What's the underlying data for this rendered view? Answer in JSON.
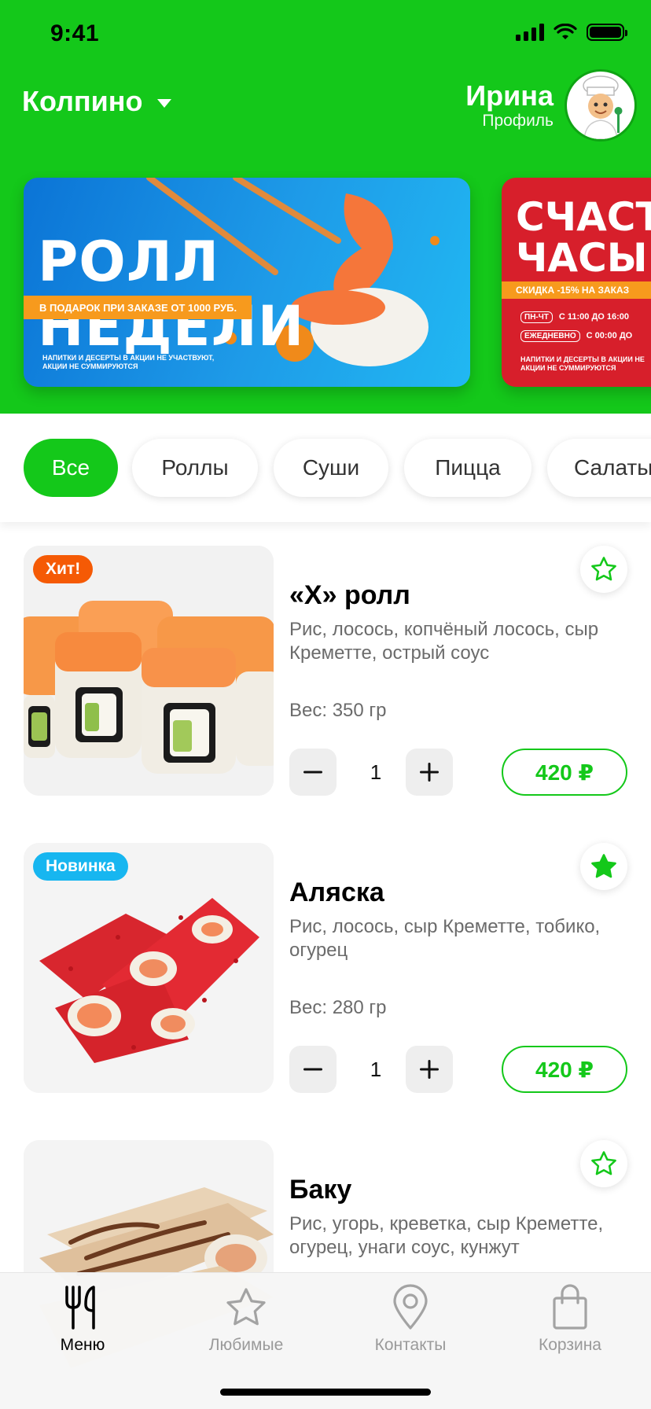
{
  "status_bar": {
    "time": "9:41"
  },
  "header": {
    "city": "Колпино",
    "profile_name": "Ирина",
    "profile_label": "Профиль"
  },
  "banners": [
    {
      "title": "РОЛЛ НЕДЕЛИ",
      "strip": "В ПОДАРОК ПРИ ЗАКАЗЕ ОТ 1000 РУБ.",
      "note": "НАПИТКИ И ДЕСЕРТЫ В АКЦИИ НЕ УЧАСТВУЮТ, АКЦИИ НЕ СУММИРУЮТСЯ"
    },
    {
      "title_line1": "СЧАСТЛ",
      "title_line2": "ЧАСЫ",
      "strip": "СКИДКА -15% НА ЗАКАЗ",
      "row1_tag": "ПН-ЧТ",
      "row1_text": "С 11:00 ДО 16:00",
      "row2_tag": "ЕЖЕДНЕВНО",
      "row2_text": "С 00:00 ДО",
      "note_line1": "НАПИТКИ И ДЕСЕРТЫ В АКЦИИ НЕ",
      "note_line2": "АКЦИИ НЕ СУММИРУЮТСЯ"
    }
  ],
  "categories": [
    {
      "label": "Все",
      "active": true
    },
    {
      "label": "Роллы",
      "active": false
    },
    {
      "label": "Суши",
      "active": false
    },
    {
      "label": "Пицца",
      "active": false
    },
    {
      "label": "Салаты",
      "active": false
    }
  ],
  "products": [
    {
      "badge": "Хит!",
      "name": "«X» ролл",
      "description": "Рис, лосось, копчёный лосось, сыр Креметте, острый соус",
      "weight": "Вес: 350 гр",
      "quantity": "1",
      "price": "420 ₽",
      "favorite": false
    },
    {
      "badge": "Новинка",
      "name": "Аляска",
      "description": "Рис, лосось, сыр Креметте, тобико, огурец",
      "weight": "Вес: 280 гр",
      "quantity": "1",
      "price": "420 ₽",
      "favorite": true
    },
    {
      "badge": "",
      "name": "Баку",
      "description": "Рис, угорь, креветка, сыр Креметте, огурец, унаги соус, кунжут",
      "favorite": false
    }
  ],
  "tabs": [
    {
      "label": "Меню",
      "icon": "fork-knife-icon",
      "active": true
    },
    {
      "label": "Любимые",
      "icon": "star-icon",
      "active": false
    },
    {
      "label": "Контакты",
      "icon": "location-pin-icon",
      "active": false
    },
    {
      "label": "Корзина",
      "icon": "shopping-bag-icon",
      "active": false
    }
  ],
  "colors": {
    "brand_green": "#14C81A",
    "hit_badge": "#F55A05",
    "new_badge": "#17B6F0"
  }
}
